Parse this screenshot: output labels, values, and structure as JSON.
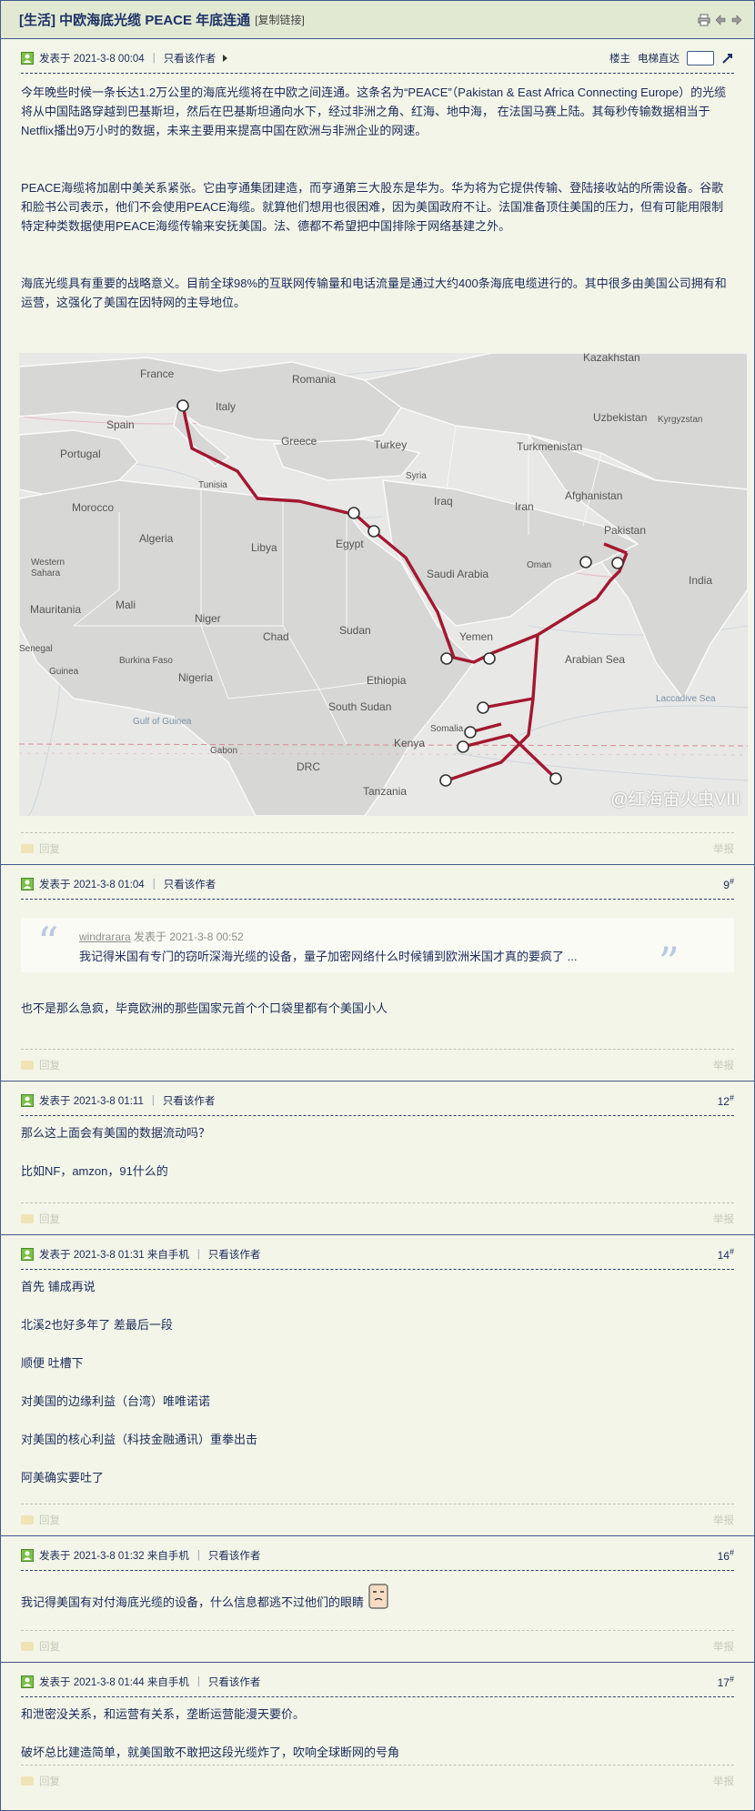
{
  "thread": {
    "category": "[生活]",
    "title": "中欧海底光缆 PEACE 年底连通",
    "copy_link": "[复制链接]"
  },
  "labels": {
    "only_author": "只看该作者",
    "reply": "回复",
    "report": "举报",
    "louzhu": "楼主",
    "elevator": "电梯直达"
  },
  "posts": [
    {
      "posted": "发表于 2021-3-8 00:04",
      "floor": "",
      "paragraphs": [
        "今年晚些时候一条长达1.2万公里的海底光缆将在中欧之间连通。这条名为“PEACE”（Pakistan & East Africa Connecting Europe）的光缆将从中国陆路穿越到巴基斯坦，然后在巴基斯坦通向水下，经过非洲之角、红海、地中海， 在法国马赛上陆。其每秒传输数据相当于Netflix播出9万小时的数据，未来主要用来提高中国在欧洲与非洲企业的网速。",
        "PEACE海缆将加剧中美关系紧张。它由亨通集团建造，而亨通第三大股东是华为。华为将为它提供传输、登陆接收站的所需设备。谷歌和脸书公司表示，他们不会使用PEACE海缆。就算他们想用也很困难，因为美国政府不让。法国准备顶住美国的压力，但有可能用限制特定种类数据使用PEACE海缆传输来安抚美国。法、德都不希望把中国排除于网络基建之外。",
        "海底光缆具有重要的战略意义。目前全球98%的互联网传输量和电话流量是通过大约400条海底电缆进行的。其中很多由美国公司拥有和运营，这强化了美国在因特网的主导地位。"
      ]
    },
    {
      "posted": "发表于 2021-3-8 01:04",
      "floor": "9",
      "quote_author": "windrarara",
      "quote_time": "发表于 2021-3-8 00:52",
      "quote_text": "我记得米国有专门的窃听深海光缆的设备，量子加密网络什么时候铺到欧洲米国才真的要疯了 ...",
      "paragraphs": [
        "也不是那么急疯，毕竟欧洲的那些国家元首个个口袋里都有个美国小人"
      ]
    },
    {
      "posted": "发表于 2021-3-8 01:11",
      "floor": "12",
      "paragraphs": [
        "那么这上面会有美国的数据流动吗？",
        "比如NF，amzon，91什么的"
      ]
    },
    {
      "posted": "发表于 2021-3-8 01:31 来自手机",
      "floor": "14",
      "paragraphs": [
        "首先 铺成再说",
        "北溪2也好多年了 差最后一段",
        "顺便 吐槽下",
        "对美国的边缘利益（台湾）唯唯诺诺",
        "对美国的核心利益（科技金融通讯）重拳出击",
        "阿美确实要吐了"
      ]
    },
    {
      "posted": "发表于 2021-3-8 01:32 来自手机",
      "floor": "16",
      "paragraphs": [
        "我记得美国有对付海底光缆的设备，什么信息都逃不过他们的眼睛"
      ]
    },
    {
      "posted": "发表于 2021-3-8 01:44 来自手机",
      "floor": "17",
      "paragraphs": [
        "和泄密没关系，和运营有关系，垄断运营能漫天要价。",
        "破坏总比建造简单，就美国敢不敢把这段光缆炸了，吹响全球断网的号角"
      ]
    }
  ],
  "map": {
    "labels": {
      "kazakhstan": "Kazakhstan",
      "france": "France",
      "romania": "Romania",
      "uzbekistan": "Uzbekistan",
      "kyrgyzstan": "Kyrgyzstan",
      "spain": "Spain",
      "italy": "Italy",
      "portugal": "Portugal",
      "greece": "Greece",
      "turkey": "Turkey",
      "turkmenistan": "Turkmenistan",
      "tunisia": "Tunisia",
      "syria": "Syria",
      "afghanistan": "Afghanistan",
      "morocco": "Morocco",
      "iraq": "Iraq",
      "iran": "Iran",
      "algeria": "Algeria",
      "libya": "Libya",
      "egypt": "Egypt",
      "pakistan": "Pakistan",
      "western_sahara": "Western Sahara",
      "saudi_arabia": "Saudi Arabia",
      "india": "India",
      "oman": "Oman",
      "mauritania": "Mauritania",
      "mali": "Mali",
      "niger": "Niger",
      "chad": "Chad",
      "sudan": "Sudan",
      "yemen": "Yemen",
      "senegal": "Senegal",
      "burkina_faso": "Burkina Faso",
      "guinea": "Guinea",
      "nigeria": "Nigeria",
      "ethiopia": "Ethiopia",
      "south_sudan": "South Sudan",
      "arabian_sea": "Arabian Sea",
      "somalia": "Somalia",
      "laccadive_sea": "Laccadive Sea",
      "gulf_of_guinea": "Gulf of Guinea",
      "gabon": "Gabon",
      "kenya": "Kenya",
      "drc": "DRC",
      "tanzania": "Tanzania"
    },
    "watermark": "@红海宙火虫VIII",
    "cable_color": "#a3182f"
  }
}
